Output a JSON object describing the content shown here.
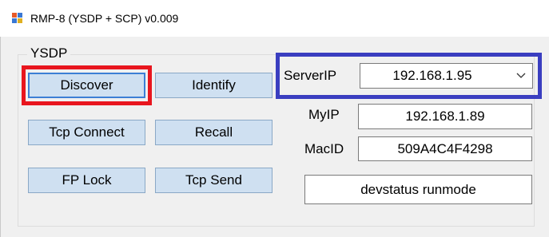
{
  "window": {
    "title": "RMP-8 (YSDP + SCP) v0.009",
    "app_icon": "app-window-icon"
  },
  "group": {
    "label": "YSDP"
  },
  "buttons": {
    "discover": "Discover",
    "identify": "Identify",
    "tcp_connect": "Tcp Connect",
    "recall": "Recall",
    "fp_lock": "FP Lock",
    "tcp_send": "Tcp Send"
  },
  "fields": {
    "server_ip_label": "ServerIP",
    "server_ip_value": "192.168.1.95",
    "my_ip_label": "MyIP",
    "my_ip_value": "192.168.1.89",
    "mac_id_label": "MacID",
    "mac_id_value": "509A4C4F4298",
    "status_value": "devstatus runmode"
  },
  "colors": {
    "highlight_red": "#e8161e",
    "highlight_blue": "#3a3ec0",
    "button_bg": "#cfe0f1"
  }
}
